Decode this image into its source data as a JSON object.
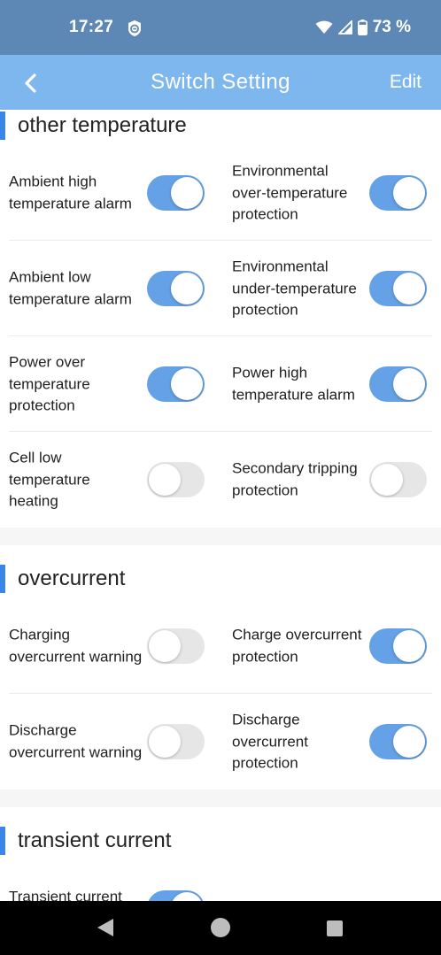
{
  "status_bar": {
    "time": "17:27",
    "battery_text": "73 %",
    "icons": [
      "app-notification-icon",
      "wifi-icon",
      "signal-icon",
      "battery-icon"
    ]
  },
  "header": {
    "title": "Switch Setting",
    "edit_label": "Edit",
    "back_icon": "chevron-left-icon",
    "background": "#7db7ee"
  },
  "colors": {
    "toggle_on": "#65a1e6",
    "toggle_off": "#e6e6e6",
    "section_accent": "#3a86e6"
  },
  "sections": [
    {
      "title": "other temperature",
      "rows": [
        [
          {
            "label": "Ambient high temperature alarm",
            "on": true
          },
          {
            "label": "Environmental over-temperature protection",
            "on": true
          }
        ],
        [
          {
            "label": "Ambient low temperature alarm",
            "on": true
          },
          {
            "label": "Environmental under-temperature protection",
            "on": true
          }
        ],
        [
          {
            "label": "Power over temperature protection",
            "on": true
          },
          {
            "label": "Power high temperature alarm",
            "on": true
          }
        ],
        [
          {
            "label": "Cell low temperature heating",
            "on": false
          },
          {
            "label": "Secondary tripping protection",
            "on": false
          }
        ]
      ]
    },
    {
      "title": "overcurrent",
      "rows": [
        [
          {
            "label": "Charging overcurrent warning",
            "on": false
          },
          {
            "label": "Charge overcurrent protection",
            "on": true
          }
        ],
        [
          {
            "label": "Discharge overcurrent warning",
            "on": false
          },
          {
            "label": "Discharge overcurrent protection",
            "on": true
          }
        ]
      ]
    },
    {
      "title": "transient current",
      "rows": [
        [
          {
            "label": "Transient current protection",
            "on": true
          }
        ]
      ]
    }
  ],
  "nav": {
    "back_icon": "triangle-back-icon",
    "home_icon": "circle-home-icon",
    "recents_icon": "square-recents-icon"
  }
}
